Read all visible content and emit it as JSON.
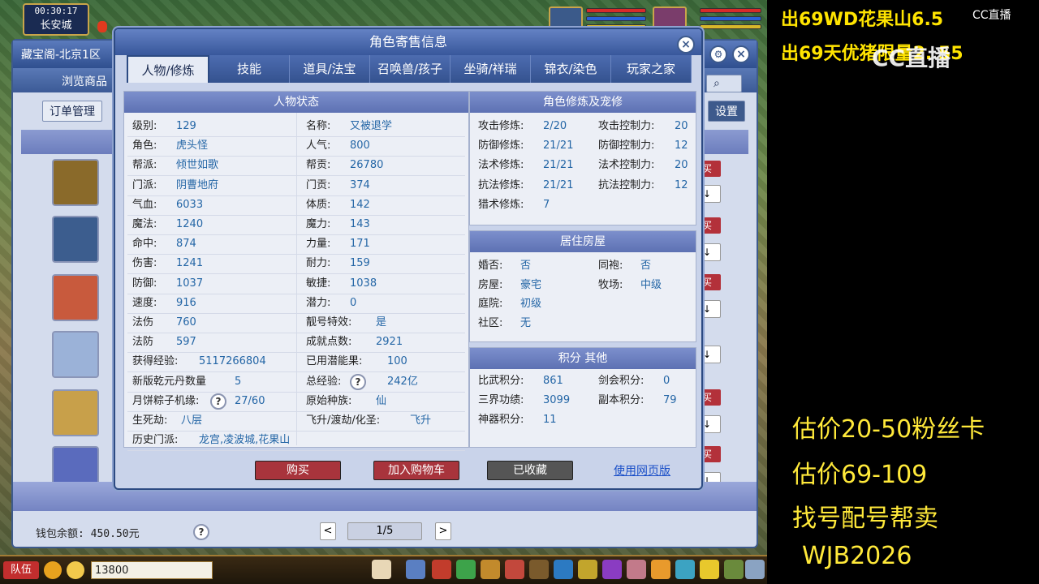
{
  "hud": {
    "time": "00:30:17",
    "city": "长安城"
  },
  "shop": {
    "title": "藏宝阁-北京1区",
    "nav_browse": "浏览商品",
    "order_mgmt": "订单管理",
    "settings": "设置",
    "wallet": "钱包余额: 450.50元",
    "page": "1/5",
    "help": "?",
    "prev": "<",
    "next": ">",
    "buy_short": "买",
    "down": "↓"
  },
  "modal": {
    "title": "角色寄售信息",
    "close": "×",
    "tabs": [
      "人物/修炼",
      "技能",
      "道具/法宝",
      "召唤兽/孩子",
      "坐骑/祥瑞",
      "锦衣/染色",
      "玩家之家"
    ],
    "status_title": "人物状态",
    "status_left": [
      {
        "k": "级别:",
        "v": "129"
      },
      {
        "k": "角色:",
        "v": "虎头怪"
      },
      {
        "k": "帮派:",
        "v": "倾世如歌"
      },
      {
        "k": "门派:",
        "v": "阴曹地府"
      },
      {
        "k": "气血:",
        "v": "6033"
      },
      {
        "k": "魔法:",
        "v": "1240"
      },
      {
        "k": "命中:",
        "v": "874"
      },
      {
        "k": "伤害:",
        "v": "1241"
      },
      {
        "k": "防御:",
        "v": "1037"
      },
      {
        "k": "速度:",
        "v": "916"
      },
      {
        "k": "法伤",
        "v": "760"
      },
      {
        "k": "法防",
        "v": "597"
      },
      {
        "k": "获得经验:",
        "v": "5117266804"
      },
      {
        "k": "新版乾元丹数量",
        "v": "5"
      },
      {
        "k": "月饼粽子机缘:",
        "v": "27/60"
      },
      {
        "k": "生死劫:",
        "v": "八层"
      },
      {
        "k": "历史门派:",
        "v": "龙宫,凌波城,花果山"
      }
    ],
    "status_right": [
      {
        "k": "名称:",
        "v": "又被退学"
      },
      {
        "k": "人气:",
        "v": "800"
      },
      {
        "k": "帮贡:",
        "v": "26780"
      },
      {
        "k": "门贡:",
        "v": "374"
      },
      {
        "k": "体质:",
        "v": "142"
      },
      {
        "k": "魔力:",
        "v": "143"
      },
      {
        "k": "力量:",
        "v": "171"
      },
      {
        "k": "耐力:",
        "v": "159"
      },
      {
        "k": "敏捷:",
        "v": "1038"
      },
      {
        "k": "潜力:",
        "v": "0"
      },
      {
        "k": "靓号特效:",
        "v": "是"
      },
      {
        "k": "成就点数:",
        "v": "2921"
      },
      {
        "k": "已用潜能果:",
        "v": "100"
      },
      {
        "k": "总经验:",
        "v": "242亿"
      },
      {
        "k": "原始种族:",
        "v": "仙"
      },
      {
        "k": "飞升/渡劫/化圣:",
        "v": "飞升"
      }
    ],
    "cultivation_title": "角色修炼及宠修",
    "cultivation": [
      {
        "k": "攻击修炼:",
        "v": "2/20",
        "k2": "攻击控制力:",
        "v2": "20"
      },
      {
        "k": "防御修炼:",
        "v": "21/21",
        "k2": "防御控制力:",
        "v2": "12"
      },
      {
        "k": "法术修炼:",
        "v": "21/21",
        "k2": "法术控制力:",
        "v2": "20"
      },
      {
        "k": "抗法修炼:",
        "v": "21/21",
        "k2": "抗法控制力:",
        "v2": "12"
      },
      {
        "k": "猎术修炼:",
        "v": "7",
        "k2": "",
        "v2": ""
      }
    ],
    "house_title": "居住房屋",
    "house": [
      {
        "k": "婚否:",
        "v": "否",
        "k2": "同袍:",
        "v2": "否"
      },
      {
        "k": "房屋:",
        "v": "豪宅",
        "k2": "牧场:",
        "v2": "中级"
      },
      {
        "k": "庭院:",
        "v": "初级",
        "k2": "",
        "v2": ""
      },
      {
        "k": "社区:",
        "v": "无",
        "k2": "",
        "v2": ""
      }
    ],
    "score_title": "积分 其他",
    "score": [
      {
        "k": "比武积分:",
        "v": "861",
        "k2": "剑会积分:",
        "v2": "0"
      },
      {
        "k": "三界功绩:",
        "v": "3099",
        "k2": "副本积分:",
        "v2": "79"
      },
      {
        "k": "神器积分:",
        "v": "11",
        "k2": "",
        "v2": ""
      }
    ],
    "buttons": {
      "buy": "购买",
      "cart": "加入购物车",
      "collected": "已收藏",
      "web": "使用网页版"
    }
  },
  "bottom": {
    "team": "队伍",
    "money": "13800"
  },
  "overlay": {
    "line1": "出69WD花果山6.5",
    "line2": "出69天优猪限量2. 55",
    "note1": "估价20-50粉丝卡",
    "note2": "估价69-109",
    "note3": "找号配号帮卖",
    "note4": "WJB2026",
    "logo": "CC直播",
    "logo_small": "CC直播"
  },
  "colors": {
    "accent": "#38579b",
    "value_text": "#2466a6",
    "buy_button": "#b3313a",
    "collected_button": "#555555",
    "overlay_yellow": "#ffe400"
  }
}
